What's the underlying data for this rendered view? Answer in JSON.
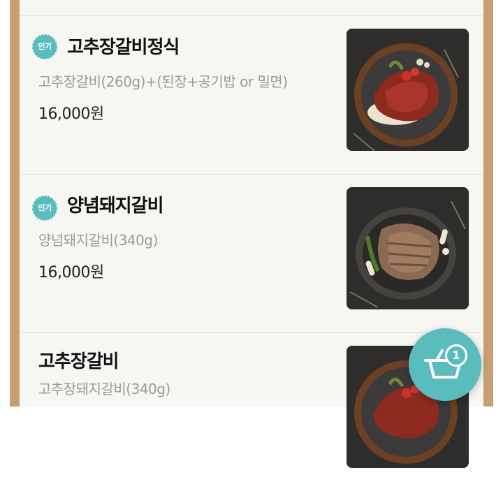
{
  "menu_items": [
    {
      "badge": "인기",
      "name": "고추장갈비정식",
      "description": "고추장갈비(260g)+(된장+공기밥 or 밀면)",
      "price": "16,000원",
      "photo": "gochujang-galbi-plate-photo"
    },
    {
      "badge": "인기",
      "name": "양념돼지갈비",
      "description": "양념돼지갈비(340g)",
      "price": "16,000원",
      "photo": "marinated-pork-ribs-photo"
    },
    {
      "badge": "",
      "name": "고추장갈비",
      "description": "고추장돼지갈비(340g)",
      "price": "",
      "photo": "gochujang-galbi-photo"
    }
  ],
  "cart": {
    "count": "1",
    "icon": "basket-icon"
  },
  "colors": {
    "accent": "#5bbcbe",
    "frame": "#c79f72",
    "panel": "#f7f6f3"
  }
}
